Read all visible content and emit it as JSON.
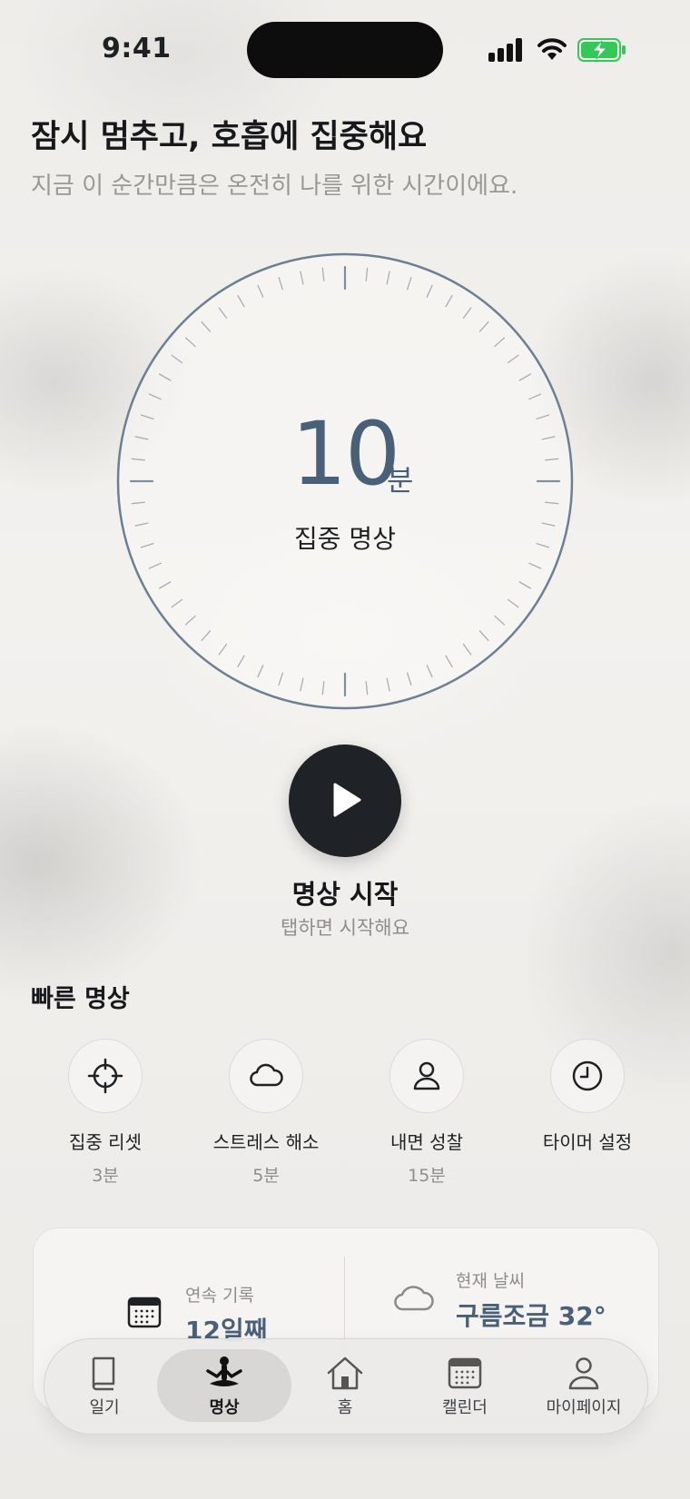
{
  "status_bar": {
    "time": "9:41"
  },
  "header": {
    "title": "잠시 멈추고, 호흡에 집중해요",
    "subtitle": "지금 이 순간만큼은 온전히 나를 위한 시간이에요."
  },
  "timer": {
    "value": "10",
    "unit": "분",
    "label": "집중 명상"
  },
  "start": {
    "label": "명상 시작",
    "hint": "탭하면 시작해요"
  },
  "quick": {
    "title": "빠른 명상",
    "items": [
      {
        "name": "집중 리셋",
        "duration": "3분",
        "icon": "crosshair-icon"
      },
      {
        "name": "스트레스 해소",
        "duration": "5분",
        "icon": "cloud-icon"
      },
      {
        "name": "내면 성찰",
        "duration": "15분",
        "icon": "person-icon"
      },
      {
        "name": "타이머 설정",
        "duration": "",
        "icon": "clock-icon"
      }
    ]
  },
  "stats": {
    "streak_label": "연속 기록",
    "streak_value": "12일째",
    "weather_label": "현재 날씨",
    "weather_value": "구름조금 32°"
  },
  "tabs": [
    {
      "label": "일기",
      "icon": "book-icon"
    },
    {
      "label": "명상",
      "icon": "meditation-icon",
      "active": true
    },
    {
      "label": "홈",
      "icon": "home-icon"
    },
    {
      "label": "캘린더",
      "icon": "calendar-icon"
    },
    {
      "label": "마이페이지",
      "icon": "person-icon"
    }
  ],
  "colors": {
    "accent": "#4a6079",
    "play_button": "#1f2226",
    "battery": "#35c759"
  }
}
